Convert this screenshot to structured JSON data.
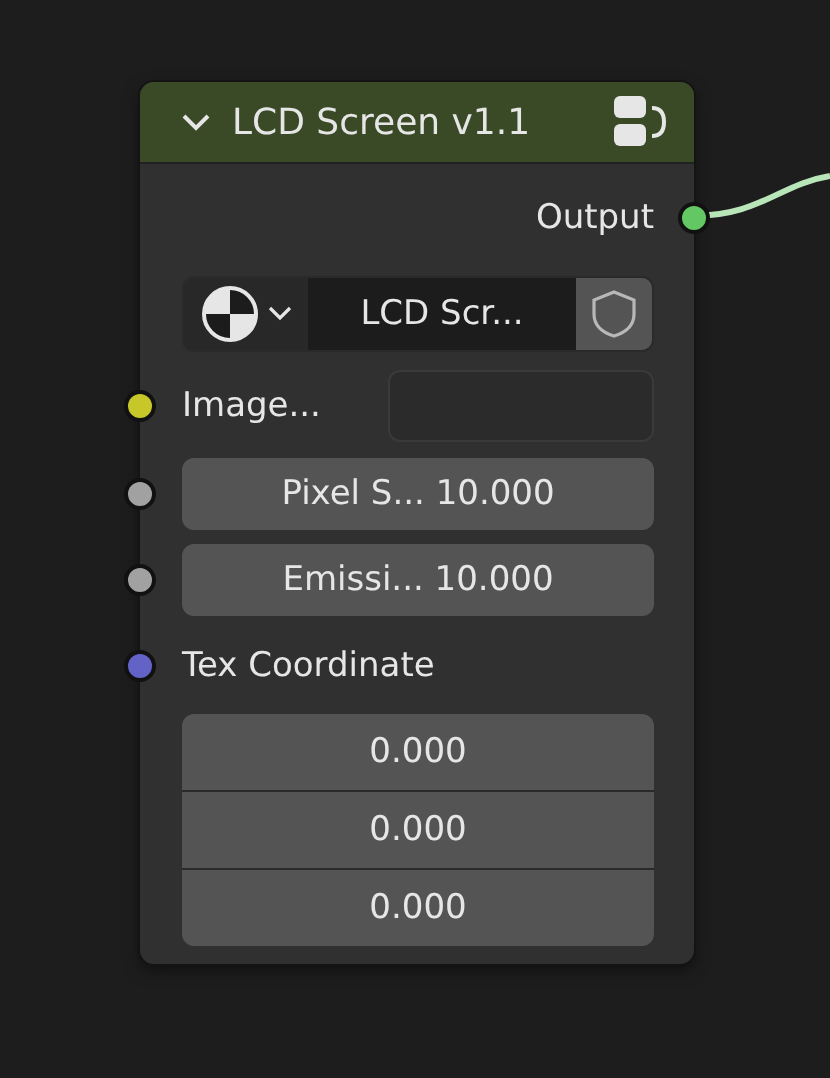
{
  "node": {
    "title": "LCD Screen v1.1",
    "expanded": true,
    "output": {
      "label": "Output",
      "color": "#63c763"
    },
    "datablock": {
      "name": "LCD Scr..."
    },
    "inputs": [
      {
        "kind": "field",
        "label": "Image...",
        "color": "#c7c729"
      },
      {
        "kind": "value",
        "label": "Pixel S...",
        "value": "10.000",
        "color": "#a1a1a1"
      },
      {
        "kind": "value",
        "label": "Emissi...",
        "value": "10.000",
        "color": "#a1a1a1"
      },
      {
        "kind": "vector",
        "label": "Tex Coordinate",
        "color": "#6363c7",
        "values": [
          "0.000",
          "0.000",
          "0.000"
        ]
      }
    ]
  }
}
